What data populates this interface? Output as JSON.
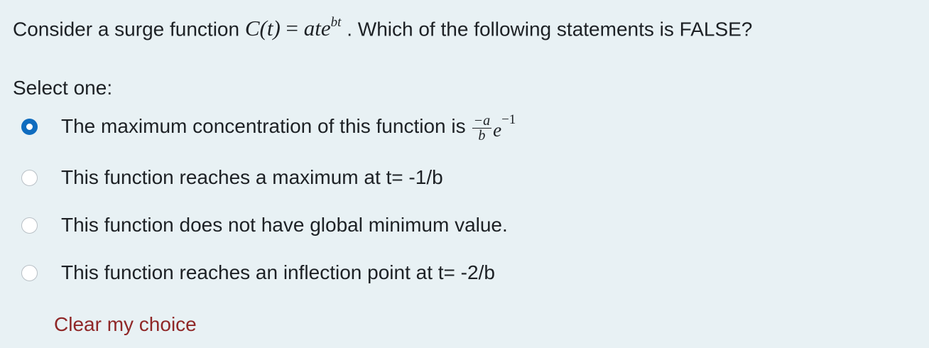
{
  "question": {
    "text_before": "Consider a surge function ",
    "formula_lhs": "C(t)",
    "formula_eq": " = ",
    "formula_rhs": "ate",
    "formula_exp": "bt",
    "text_after": " . Which of the following statements is FALSE?"
  },
  "prompt": "Select one:",
  "options": [
    {
      "label": "The maximum concentration of this function is",
      "fraction_numerator": "−a",
      "fraction_denominator": "b",
      "exp_base": "e",
      "exp_power": "−1",
      "selected": true
    },
    {
      "label": "This function reaches a maximum at t= -1/b",
      "selected": false
    },
    {
      "label": "This function does not have global minimum value.",
      "selected": false
    },
    {
      "label": "This function reaches an inflection point at t= -2/b",
      "selected": false
    }
  ],
  "clear_choice": "Clear my choice",
  "colors": {
    "background": "#e8f1f4",
    "radio_selected": "#0f6cbf",
    "link": "#8f2727",
    "text": "#1d2125"
  }
}
